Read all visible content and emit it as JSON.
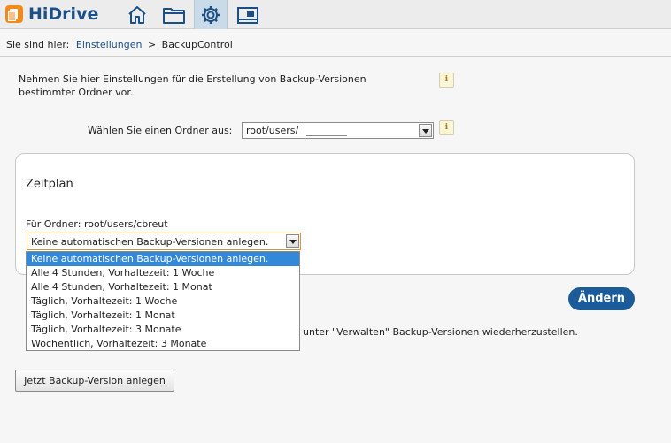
{
  "app": {
    "title": "HiDrive"
  },
  "nav": {
    "icons": [
      "home-icon",
      "folder-icon",
      "settings-icon",
      "gallery-icon"
    ],
    "active": "settings-icon",
    "accent": "#1c4f86"
  },
  "breadcrumb": {
    "prefix": "Sie sind hier:",
    "link": "Einstellungen",
    "separator": ">",
    "current": "BackupControl"
  },
  "intro": {
    "text": "Nehmen Sie hier Einstellungen für die Erstellung von Backup-Versionen bestimmter Ordner vor.",
    "info": "i"
  },
  "folder": {
    "label": "Wählen Sie einen Ordner aus:",
    "value": "root/users/",
    "info": "i"
  },
  "schedule": {
    "title": "Zeitplan",
    "for_folder": "Für Ordner: root/users/cbreut",
    "selected": "Keine automatischen Backup-Versionen anlegen.",
    "options": [
      "Keine automatischen Backup-Versionen anlegen.",
      "Alle 4 Stunden, Vorhaltezeit: 1 Woche",
      "Alle 4 Stunden, Vorhaltezeit: 1 Monat",
      "Täglich, Vorhaltezeit: 1 Woche",
      "Täglich, Vorhaltezeit: 1 Monat",
      "Täglich, Vorhaltezeit: 3 Monate",
      "Wöchentlich, Vorhaltezeit: 3 Monate"
    ]
  },
  "actions": {
    "change": "Ändern",
    "restore_text": "unter \"Verwalten\" Backup-Versionen wiederherzustellen.",
    "create": "Jetzt Backup-Version anlegen"
  }
}
